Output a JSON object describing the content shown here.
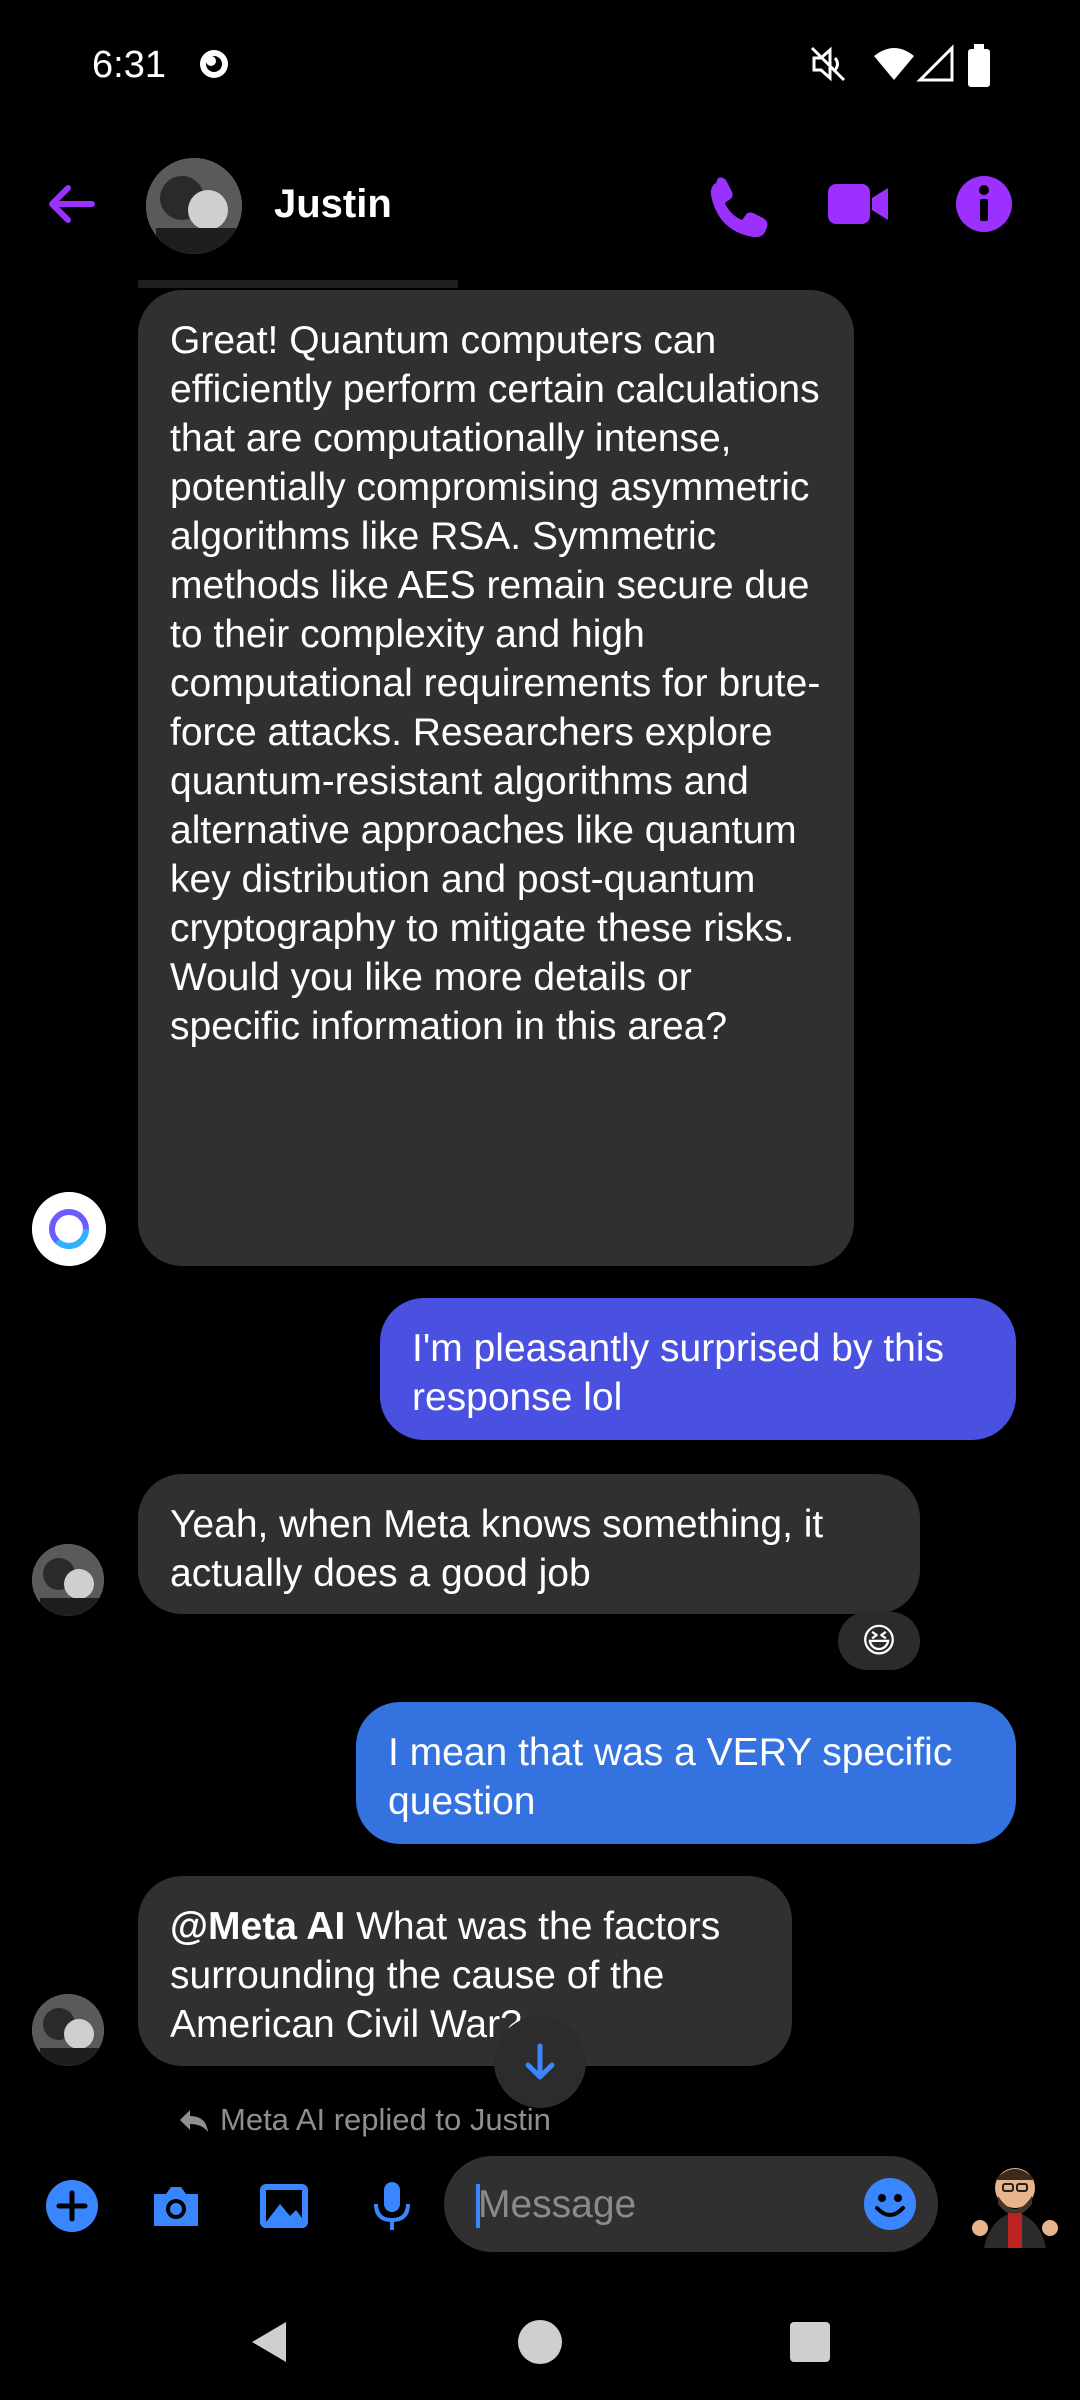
{
  "status_bar": {
    "time": "6:31"
  },
  "header": {
    "contact_name": "Justin"
  },
  "messages": [
    {
      "sender": "meta-ai",
      "text": "Great! Quantum computers can efficiently perform certain calculations that are computationally intense, potentially compromising asymmetric algorithms like RSA. Symmetric methods like AES remain secure due to their complexity and high computational requirements for brute-force attacks. Researchers explore quantum-resistant algorithms and alternative approaches like quantum key distribution and post-quantum cryptography to mitigate these risks. Would you like more details or specific information in this area?"
    },
    {
      "sender": "me",
      "text": "I'm pleasantly surprised by this response lol"
    },
    {
      "sender": "justin",
      "text": "Yeah, when Meta knows something, it actually does a good job",
      "reaction": "😆"
    },
    {
      "sender": "me",
      "text": "I mean that was a VERY specific question"
    },
    {
      "sender": "justin",
      "mention": "@Meta AI",
      "text": " What was the factors surrounding the cause of the American Civil War?"
    }
  ],
  "reply_note": "Meta AI replied to Justin",
  "composer": {
    "placeholder": "Message"
  },
  "colors": {
    "accent_purple": "#9b30ff",
    "bubble_incoming": "#303030",
    "bubble_out_purple": "#4a50e0",
    "bubble_out_blue": "#3472e0",
    "composer_icon_blue": "#3a86ff"
  },
  "icons": {
    "header": [
      "back-arrow-icon",
      "phone-icon",
      "video-camera-icon",
      "info-icon"
    ],
    "composer": [
      "plus-icon",
      "camera-icon",
      "gallery-icon",
      "microphone-icon",
      "emoji-icon"
    ],
    "nav": [
      "back-triangle-icon",
      "home-circle-icon",
      "recents-square-icon"
    ]
  }
}
